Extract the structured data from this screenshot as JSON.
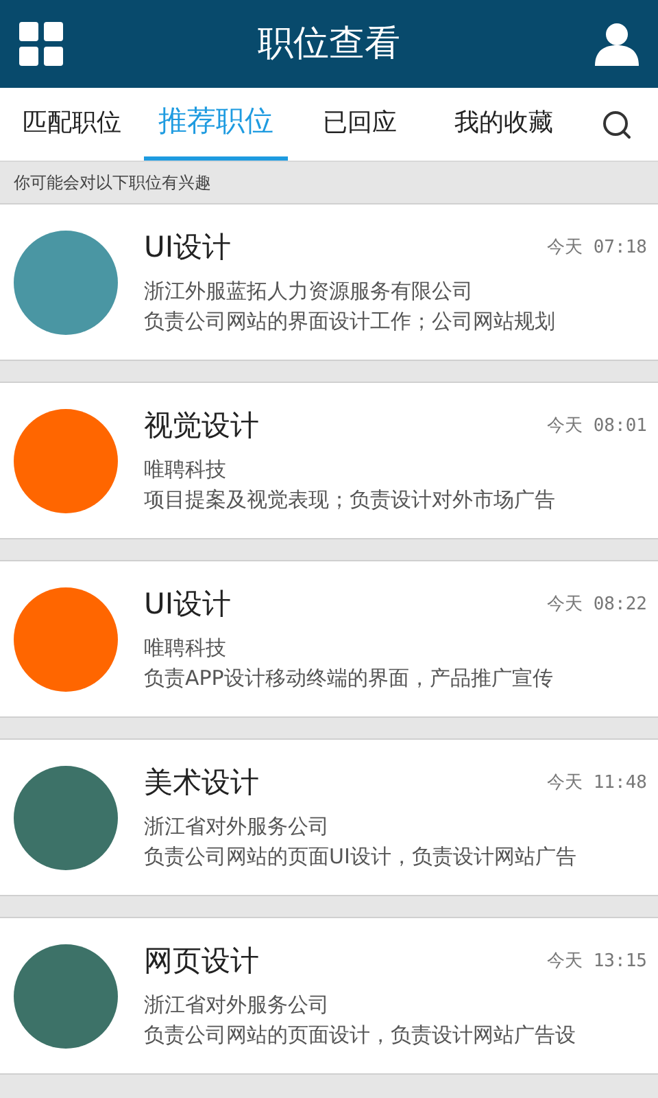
{
  "header": {
    "title": "职位查看"
  },
  "tabs": [
    {
      "label": "匹配职位",
      "selected": false
    },
    {
      "label": "推荐职位",
      "selected": true
    },
    {
      "label": "已回应",
      "selected": false
    },
    {
      "label": "我的收藏",
      "selected": false
    }
  ],
  "section_label": "你可能会对以下职位有兴趣",
  "jobs": [
    {
      "title": "UI设计",
      "time": "今天 07:18",
      "company": "浙江外服蓝拓人力资源服务有限公司",
      "description": "负责公司网站的界面设计工作；公司网站规划",
      "color": "#4a96a3"
    },
    {
      "title": "视觉设计",
      "time": "今天 08:01",
      "company": "唯聘科技",
      "description": "项目提案及视觉表现；负责设计对外市场广告",
      "color": "#ff6600"
    },
    {
      "title": "UI设计",
      "time": "今天 08:22",
      "company": "唯聘科技",
      "description": "负责APP设计移动终端的界面，产品推广宣传",
      "color": "#ff6600"
    },
    {
      "title": "美术设计",
      "time": "今天 11:48",
      "company": "浙江省对外服务公司",
      "description": "负责公司网站的页面UI设计，负责设计网站广告",
      "color": "#3d7268"
    },
    {
      "title": "网页设计",
      "time": "今天 13:15",
      "company": "浙江省对外服务公司",
      "description": "负责公司网站的页面设计，负责设计网站广告设",
      "color": "#3d7268"
    }
  ]
}
